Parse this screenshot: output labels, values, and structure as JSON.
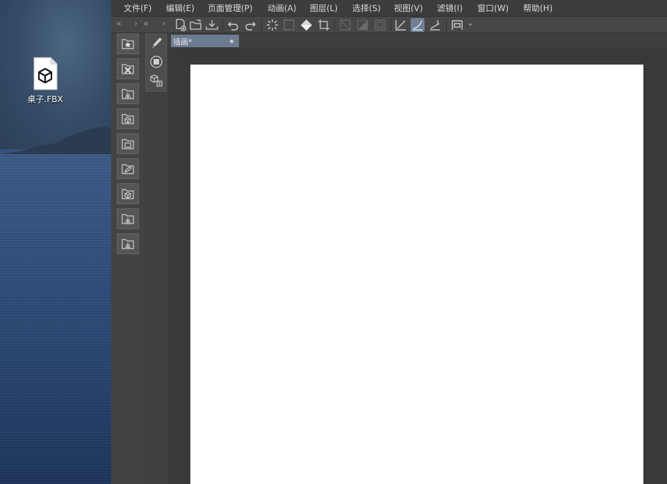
{
  "desktop": {
    "icon": {
      "name": "桌子.FBX",
      "type": "fbx-file-icon"
    }
  },
  "app": {
    "menu": [
      {
        "label": "文件(F)"
      },
      {
        "label": "编辑(E)"
      },
      {
        "label": "页面管理(P)"
      },
      {
        "label": "动画(A)"
      },
      {
        "label": "图层(L)"
      },
      {
        "label": "选择(S)"
      },
      {
        "label": "视图(V)"
      },
      {
        "label": "滤镜(I)"
      },
      {
        "label": "窗口(W)"
      },
      {
        "label": "帮助(H)"
      }
    ],
    "toolbar": {
      "nav": [
        "«",
        "›",
        "«",
        "›"
      ],
      "icons": [
        "new-canvas-icon",
        "open-folder-icon",
        "import-icon",
        "undo-icon",
        "redo-icon",
        "clear-icon",
        "transform-icon",
        "fill-icon",
        "crop-icon",
        "ruler-off-icon",
        "snap-icon",
        "frame-icon",
        "snap-ruler-icon",
        "snap-curve-icon",
        "snap-grid-icon",
        "settings-dropdown-icon"
      ],
      "active_icon": "snap-curve-icon",
      "dropdown_glyph": "⌄"
    },
    "file_buttons": [
      "favorites-icon",
      "close-file-icon",
      "export-icon",
      "3d-export-icon",
      "image-folder-icon",
      "edit-folder-icon",
      "3d-folder-icon",
      "download-icon",
      "save-icon"
    ],
    "tools": [
      "pen-icon",
      "layer-icon",
      "3d-object-icon"
    ],
    "document_tab": {
      "title": "插画*",
      "modified_indicator": "●"
    },
    "accent": "#6e7f96"
  }
}
